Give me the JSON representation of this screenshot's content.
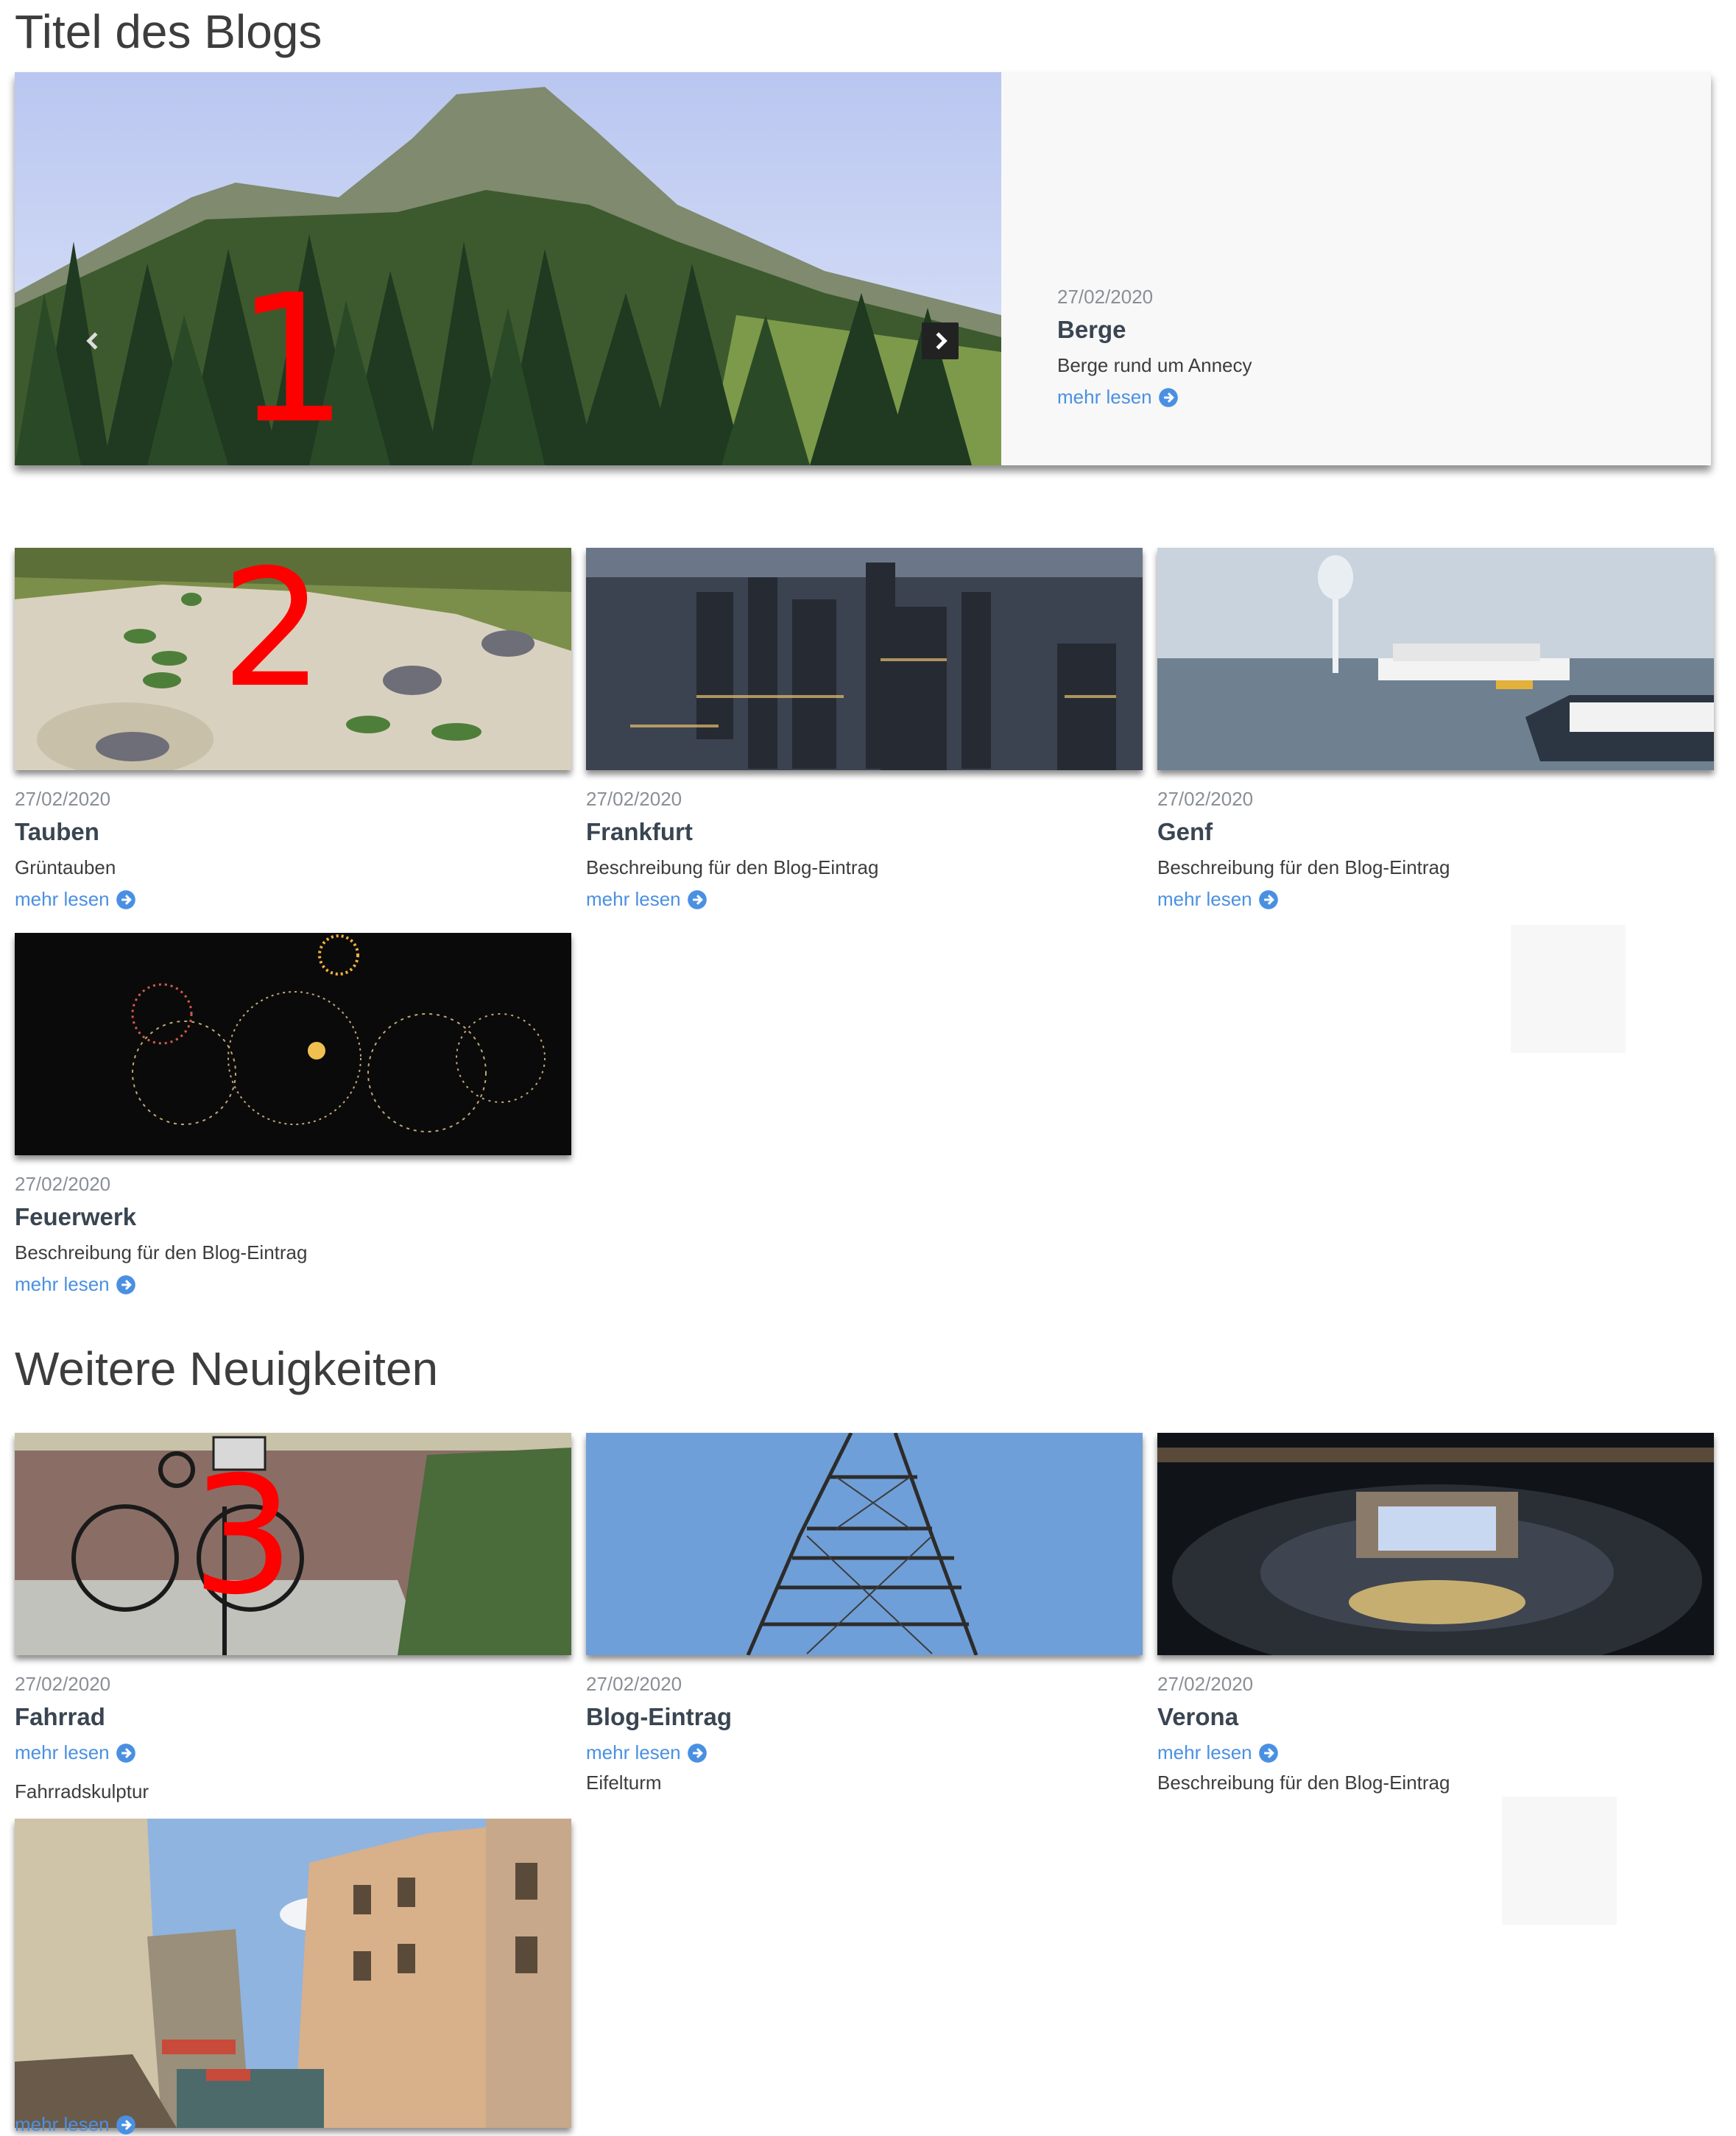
{
  "page": {
    "title": "Titel des Blogs",
    "section2_title": "Weitere Neuigkeiten"
  },
  "colors": {
    "accent": "#4a90e2",
    "marker": "#ff0000",
    "text": "#3a4552",
    "muted": "#8a8f96"
  },
  "hero": {
    "marker": "1",
    "date": "27/02/2020",
    "title": "Berge",
    "description": "Berge rund um Annecy",
    "more": "mehr lesen",
    "prev_icon": "chevron-left-icon",
    "next_icon": "chevron-right-icon",
    "slides": 3,
    "active_slide": 2
  },
  "featured": {
    "marker": "2",
    "posts": [
      {
        "date": "27/02/2020",
        "title": "Tauben",
        "description": "Grüntauben",
        "more": "mehr lesen"
      },
      {
        "date": "27/02/2020",
        "title": "Frankfurt",
        "description": "Beschreibung für den Blog-Eintrag",
        "more": "mehr lesen"
      },
      {
        "date": "27/02/2020",
        "title": "Genf",
        "description": "Beschreibung für den Blog-Eintrag",
        "more": "mehr lesen"
      },
      {
        "date": "27/02/2020",
        "title": "Feuerwerk",
        "description": "Beschreibung für den Blog-Eintrag",
        "more": "mehr lesen"
      }
    ]
  },
  "news": {
    "marker": "3",
    "posts": [
      {
        "date": "27/02/2020",
        "title": "Fahrrad",
        "more": "mehr lesen",
        "description": "Fahrradskulptur"
      },
      {
        "date": "27/02/2020",
        "title": "Blog-Eintrag",
        "more": "mehr lesen",
        "description": "Eifelturm"
      },
      {
        "date": "27/02/2020",
        "title": "Verona",
        "more": "mehr lesen",
        "description": "Beschreibung für den Blog-Eintrag"
      },
      {
        "more": "mehr lesen"
      }
    ]
  },
  "icons": {
    "more": "arrow-right-circle-icon"
  }
}
